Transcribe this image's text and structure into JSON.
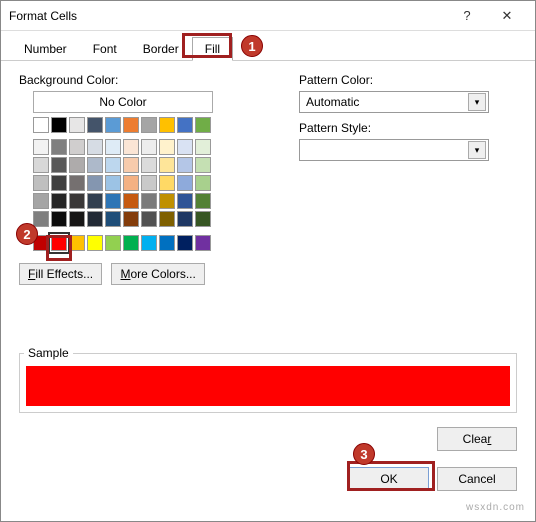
{
  "window": {
    "title": "Format Cells"
  },
  "tabs": {
    "number": "Number",
    "font": "Font",
    "border": "Border",
    "fill": "Fill"
  },
  "left_panel": {
    "bg_label": "Background Color:",
    "no_color": "No Color",
    "fill_effects": "Fill Effects...",
    "more_colors": "More Colors..."
  },
  "right_panel": {
    "pattern_color_label": "Pattern Color:",
    "pattern_color_value": "Automatic",
    "pattern_style_label": "Pattern Style:"
  },
  "sample": {
    "label": "Sample",
    "color": "#ff0000"
  },
  "buttons": {
    "clear": "Clear",
    "ok": "OK",
    "cancel": "Cancel"
  },
  "callouts": {
    "c1": "1",
    "c2": "2",
    "c3": "3"
  },
  "theme_colors_rows": [
    [
      "#ffffff",
      "#000000",
      "#e7e6e6",
      "#44546a",
      "#5b9bd5",
      "#ed7d31",
      "#a5a5a5",
      "#ffc000",
      "#4472c4",
      "#70ad47"
    ],
    [
      "#f2f2f2",
      "#7f7f7f",
      "#d0cece",
      "#d6dce4",
      "#deebf6",
      "#fbe5d5",
      "#ededed",
      "#fff2cc",
      "#d9e2f3",
      "#e2efd9"
    ],
    [
      "#d8d8d8",
      "#595959",
      "#aeabab",
      "#adb9ca",
      "#bdd7ee",
      "#f7cbac",
      "#dbdbdb",
      "#fee599",
      "#b4c6e7",
      "#c5e0b3"
    ],
    [
      "#bfbfbf",
      "#3f3f3f",
      "#757070",
      "#8496b0",
      "#9cc3e5",
      "#f4b183",
      "#c9c9c9",
      "#ffd965",
      "#8eaadb",
      "#a8d08d"
    ],
    [
      "#a5a5a5",
      "#262626",
      "#3a3838",
      "#323f4f",
      "#2e75b5",
      "#c55a11",
      "#7b7b7b",
      "#bf9000",
      "#2f5496",
      "#538135"
    ],
    [
      "#7f7f7f",
      "#0c0c0c",
      "#171616",
      "#222a35",
      "#1f4e79",
      "#833c0b",
      "#525252",
      "#7f6000",
      "#1f3864",
      "#375623"
    ]
  ],
  "standard_colors": [
    "#c00000",
    "#ff0000",
    "#ffc000",
    "#ffff00",
    "#92d050",
    "#00b050",
    "#00b0f0",
    "#0070c0",
    "#002060",
    "#7030a0"
  ],
  "selected_standard_index": 1,
  "watermark": "wsxdn.com"
}
